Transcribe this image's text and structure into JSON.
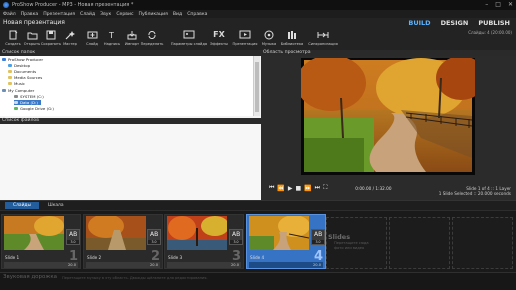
{
  "window": {
    "title": "ProShow Producer - MP3 - Новая презентация *",
    "controls": [
      "–",
      "□",
      "✕"
    ]
  },
  "menu": [
    "Файл",
    "Правка",
    "Презентация",
    "Слайд",
    "Звук",
    "Сервис",
    "Публикация",
    "Вид",
    "Справка"
  ],
  "project": {
    "name": "Новая презентация",
    "modes": [
      "BUILD",
      "DESIGN",
      "PUBLISH"
    ],
    "active_mode": "BUILD",
    "slides_info": "Слайды: 4 (20:00.00)"
  },
  "toolbar": [
    {
      "label": "Создать",
      "icon": "new-icon"
    },
    {
      "label": "Открыть",
      "icon": "open-folder-icon"
    },
    {
      "label": "Сохранить",
      "icon": "save-icon"
    },
    {
      "label": "Мастер",
      "icon": "wizard-icon"
    },
    {
      "label": "Слайд",
      "icon": "slide-icon"
    },
    {
      "label": "Надпись",
      "icon": "caption-icon"
    },
    {
      "label": "Импорт",
      "icon": "import-icon"
    },
    {
      "label": "Переделать",
      "icon": "remix-icon"
    },
    {
      "label": "Параметры слайда",
      "icon": "slide-options-icon"
    },
    {
      "label": "Эффекты",
      "icon": "effects-icon"
    },
    {
      "label": "Презентация",
      "icon": "show-options-icon"
    },
    {
      "label": "Музыка",
      "icon": "music-icon"
    },
    {
      "label": "Библиотека",
      "icon": "library-icon"
    },
    {
      "label": "Синхронизация",
      "icon": "sync-icon"
    }
  ],
  "folders_panel": {
    "title": "Список папок",
    "items": [
      {
        "label": "ProShow Producer",
        "indent": 0,
        "selected": false
      },
      {
        "label": "Desktop",
        "indent": 1,
        "selected": false
      },
      {
        "label": "Documents",
        "indent": 1,
        "selected": false
      },
      {
        "label": "Media Sources",
        "indent": 1,
        "selected": false
      },
      {
        "label": "Music",
        "indent": 1,
        "selected": false
      },
      {
        "label": "My Computer",
        "indent": 0,
        "selected": false
      },
      {
        "label": "SYSTEM (C:)",
        "indent": 2,
        "selected": false
      },
      {
        "label": "Data (D:)",
        "indent": 2,
        "selected": true
      },
      {
        "label": "Google Drive (G:)",
        "indent": 2,
        "selected": false
      }
    ]
  },
  "files_panel": {
    "title": "Список файлов"
  },
  "preview": {
    "title": "Область просмотра",
    "timecode": "0:00.00 / 1:32.00",
    "slide_info": "Slide 1 of 4 :: 1 Layer",
    "selection_info": "1 Slide Selected :: 20.000 seconds"
  },
  "tabs": [
    "Слайды",
    "Шкала"
  ],
  "slides": [
    {
      "label": "Slide 1",
      "number": "1",
      "duration": "20.0",
      "transition": "3.0",
      "selected": false
    },
    {
      "label": "Slide 2",
      "number": "2",
      "duration": "20.0",
      "transition": "3.0",
      "selected": false
    },
    {
      "label": "Slide 3",
      "number": "3",
      "duration": "20.0",
      "transition": "3.0",
      "selected": false
    },
    {
      "label": "Slide 4",
      "number": "4",
      "duration": "20.0",
      "transition": "3.0",
      "selected": true
    }
  ],
  "empty_slot": {
    "title": "Slides",
    "hint": "Перетащите сюда фото или видео"
  },
  "soundtrack": {
    "title": "Звуковая дорожка",
    "hint": "Перетащите музыку в эту область. Дважды щёлкните для редактирования."
  },
  "colors": {
    "accent": "#5cb3ff",
    "selection": "#3673c4",
    "tab_active": "#245d9c"
  }
}
